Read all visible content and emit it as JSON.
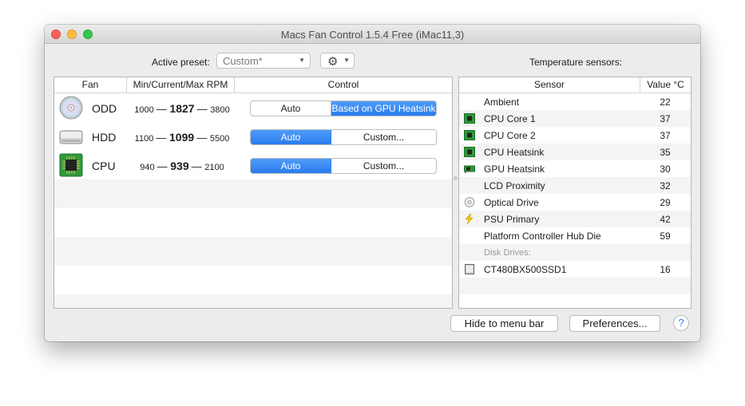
{
  "window": {
    "title": "Macs Fan Control 1.5.4 Free (iMac11,3)"
  },
  "preset": {
    "label": "Active preset:",
    "value": "Custom*"
  },
  "sensors_label": "Temperature sensors:",
  "fan_table": {
    "headers": [
      "Fan",
      "Min/Current/Max RPM",
      "Control"
    ],
    "rows": [
      {
        "name": "ODD",
        "icon": "optical-drive-icon",
        "min": "1000",
        "current": "1827",
        "max": "3800",
        "control_left": "Auto",
        "control_right": "Based on GPU Heatsink",
        "active": "right"
      },
      {
        "name": "HDD",
        "icon": "hard-drive-icon",
        "min": "1100",
        "current": "1099",
        "max": "5500",
        "control_left": "Auto",
        "control_right": "Custom...",
        "active": "left"
      },
      {
        "name": "CPU",
        "icon": "cpu-chip-icon",
        "min": "940",
        "current": "939",
        "max": "2100",
        "control_left": "Auto",
        "control_right": "Custom...",
        "active": "left"
      }
    ]
  },
  "sensor_table": {
    "headers": [
      "Sensor",
      "Value °C"
    ],
    "rows": [
      {
        "name": "Ambient",
        "value": "22",
        "icon": ""
      },
      {
        "name": "CPU Core 1",
        "value": "37",
        "icon": "cpu-chip-icon"
      },
      {
        "name": "CPU Core 2",
        "value": "37",
        "icon": "cpu-chip-icon"
      },
      {
        "name": "CPU Heatsink",
        "value": "35",
        "icon": "cpu-chip-icon"
      },
      {
        "name": "GPU Heatsink",
        "value": "30",
        "icon": "gpu-card-icon"
      },
      {
        "name": "LCD Proximity",
        "value": "32",
        "icon": ""
      },
      {
        "name": "Optical Drive",
        "value": "29",
        "icon": "optical-drive-icon"
      },
      {
        "name": "PSU Primary",
        "value": "42",
        "icon": "lightning-icon"
      },
      {
        "name": "Platform Controller Hub Die",
        "value": "59",
        "icon": ""
      },
      {
        "name": "Disk Drives:",
        "value": "",
        "icon": "",
        "group": true
      },
      {
        "name": "CT480BX500SSD1",
        "value": "16",
        "icon": "ssd-drive-icon"
      }
    ]
  },
  "buttons": {
    "hide": "Hide to menu bar",
    "prefs": "Preferences...",
    "help": "?"
  },
  "colors": {
    "accent": "#2a7cf0",
    "window_bg": "#ececec"
  }
}
